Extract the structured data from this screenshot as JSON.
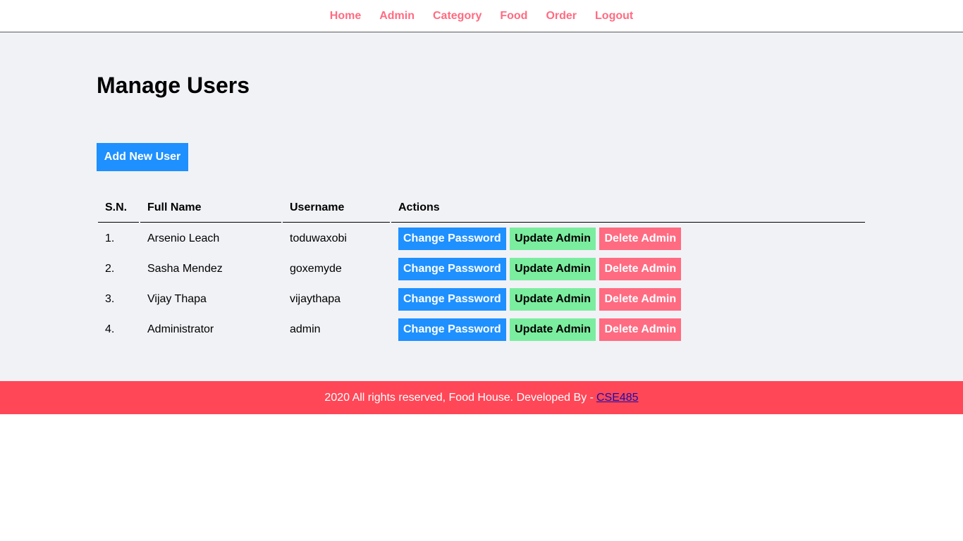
{
  "menu": {
    "items": [
      "Home",
      "Admin",
      "Category",
      "Food",
      "Order",
      "Logout"
    ]
  },
  "main": {
    "title": "Manage Users",
    "add_button": "Add New User",
    "table": {
      "headers": [
        "S.N.",
        "Full Name",
        "Username",
        "Actions"
      ],
      "rows": [
        {
          "sn": "1.",
          "full_name": "Arsenio Leach",
          "username": "toduwaxobi"
        },
        {
          "sn": "2.",
          "full_name": "Sasha Mendez",
          "username": "goxemyde"
        },
        {
          "sn": "3.",
          "full_name": "Vijay Thapa",
          "username": "vijaythapa"
        },
        {
          "sn": "4.",
          "full_name": "Administrator",
          "username": "admin"
        }
      ],
      "actions": {
        "change_password": "Change Password",
        "update_admin": "Update Admin",
        "delete_admin": "Delete Admin"
      }
    }
  },
  "footer": {
    "text": "2020 All rights reserved, Food House. Developed By -",
    "link": "CSE485"
  },
  "colors": {
    "menu_link": "#ff6b81",
    "primary": "#1e90ff",
    "secondary": "#7bed9f",
    "danger": "#ff6b81",
    "footer_bg": "#ff4757",
    "main_bg": "#f1f2f6"
  }
}
